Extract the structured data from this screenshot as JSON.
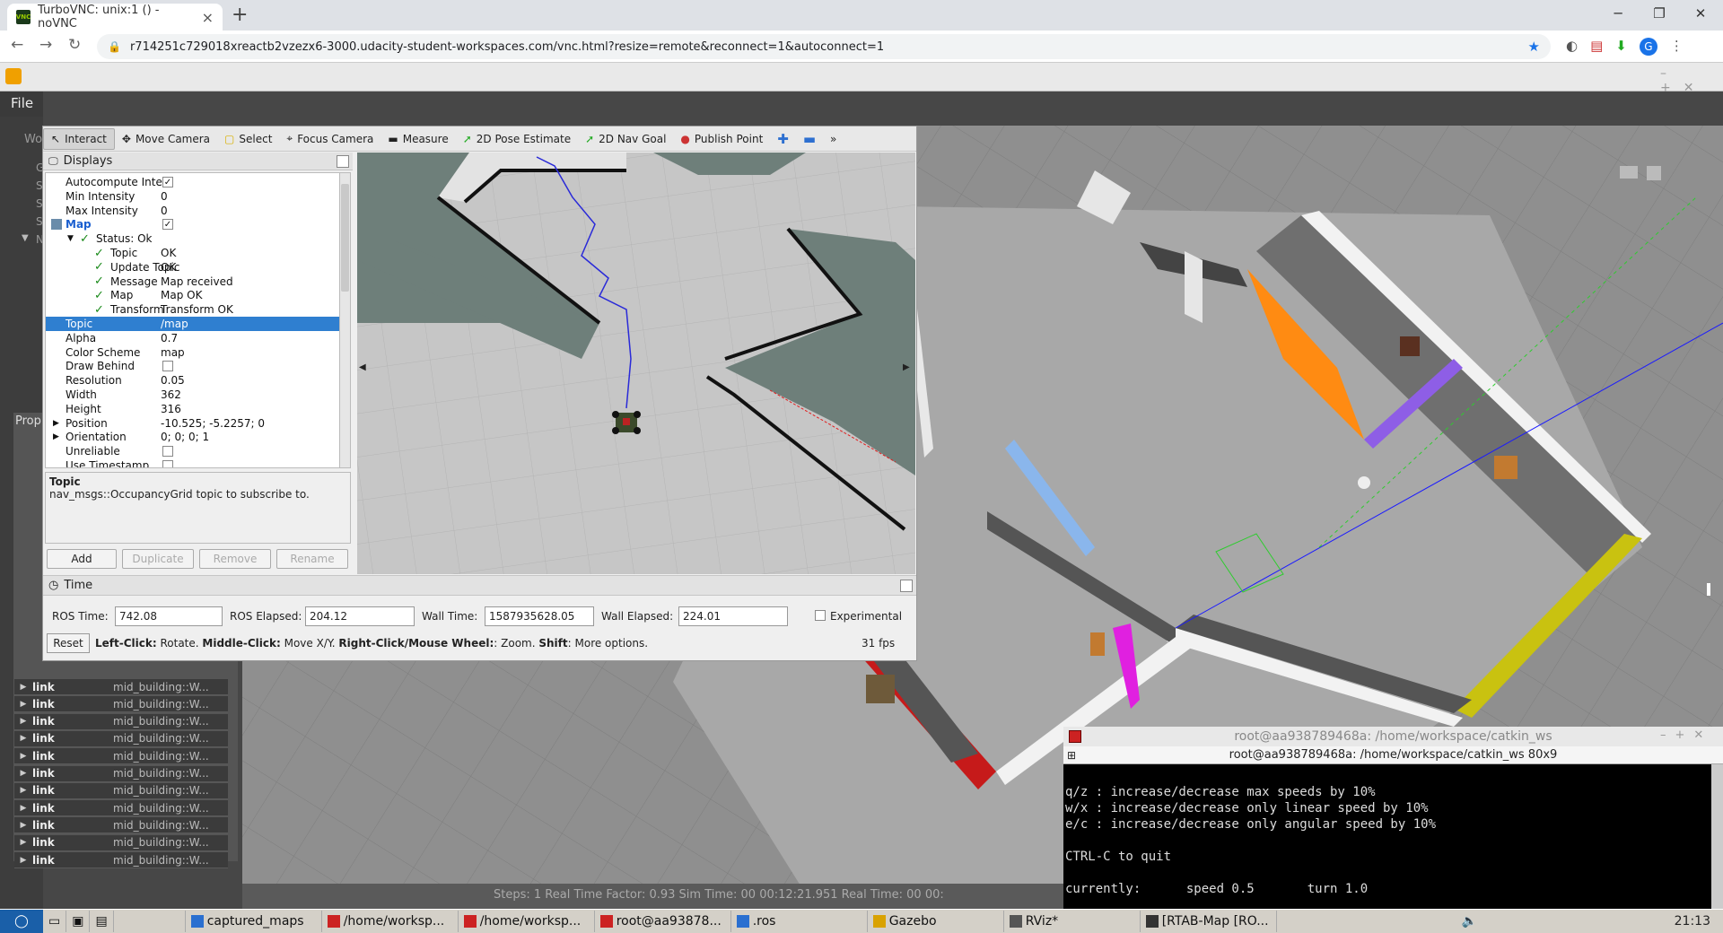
{
  "browser": {
    "tab_title": "TurboVNC: unix:1 () - noVNC",
    "favicon_text": "VNC",
    "url": "r714251c729018xreactb2vzezx6-3000.udacity-student-workspaces.com/vnc.html?resize=remote&reconnect=1&autoconnect=1",
    "profile": "G"
  },
  "gazebo": {
    "menu_file": "File",
    "left_labels": [
      "Wo",
      "G",
      "S",
      "S",
      "S",
      "N"
    ],
    "props_label": "Prop",
    "link_rows": [
      {
        "k": "link",
        "v": "mid_building::W..."
      },
      {
        "k": "link",
        "v": "mid_building::W..."
      },
      {
        "k": "link",
        "v": "mid_building::W..."
      },
      {
        "k": "link",
        "v": "mid_building::W..."
      },
      {
        "k": "link",
        "v": "mid_building::W..."
      },
      {
        "k": "link",
        "v": "mid_building::W..."
      },
      {
        "k": "link",
        "v": "mid_building::W..."
      },
      {
        "k": "link",
        "v": "mid_building::W..."
      },
      {
        "k": "link",
        "v": "mid_building::W..."
      },
      {
        "k": "link",
        "v": "mid_building::W..."
      },
      {
        "k": "link",
        "v": "mid_building::W..."
      }
    ],
    "bottom_bar": "Steps: 1    Real Time Factor: 0.93    Sim Time: 00 00:12:21.951    Real Time: 00 00:"
  },
  "rviz": {
    "tools": [
      "Interact",
      "Move Camera",
      "Select",
      "Focus Camera",
      "Measure",
      "2D Pose Estimate",
      "2D Nav Goal",
      "Publish Point"
    ],
    "displays_title": "Displays",
    "tree": [
      {
        "k": "Autocompute Inte...",
        "v": "",
        "check": "checked",
        "indent": 22
      },
      {
        "k": "Min Intensity",
        "v": "0",
        "indent": 22
      },
      {
        "k": "Max Intensity",
        "v": "0",
        "indent": 22
      },
      {
        "k": "Map",
        "v": "",
        "check": "checked",
        "indent": 22,
        "bold": true
      },
      {
        "k": "Status: Ok",
        "v": "",
        "indent": 40,
        "green": true,
        "expand": true
      },
      {
        "k": "Topic",
        "v": "OK",
        "indent": 56,
        "green": true
      },
      {
        "k": "Update Topic",
        "v": "OK",
        "indent": 56,
        "green": true
      },
      {
        "k": "Message",
        "v": "Map received",
        "indent": 56,
        "green": true
      },
      {
        "k": "Map",
        "v": "Map OK",
        "indent": 56,
        "green": true
      },
      {
        "k": "Transform",
        "v": "Transform OK",
        "indent": 56,
        "green": true
      },
      {
        "k": "Topic",
        "v": "/map",
        "indent": 22,
        "sel": true
      },
      {
        "k": "Alpha",
        "v": "0.7",
        "indent": 22
      },
      {
        "k": "Color Scheme",
        "v": "map",
        "indent": 22
      },
      {
        "k": "Draw Behind",
        "v": "",
        "check": "unchecked",
        "indent": 22
      },
      {
        "k": "Resolution",
        "v": "0.05",
        "indent": 22
      },
      {
        "k": "Width",
        "v": "362",
        "indent": 22
      },
      {
        "k": "Height",
        "v": "316",
        "indent": 22
      },
      {
        "k": "Position",
        "v": "-10.525; -5.2257; 0",
        "indent": 22,
        "expand_right": true
      },
      {
        "k": "Orientation",
        "v": "0; 0; 0; 1",
        "indent": 22,
        "expand_right": true
      },
      {
        "k": "Unreliable",
        "v": "",
        "check": "unchecked",
        "indent": 22
      },
      {
        "k": "Use Timestamp",
        "v": "",
        "check": "unchecked",
        "indent": 22
      }
    ],
    "desc_title": "Topic",
    "desc_text": "nav_msgs::OccupancyGrid topic to subscribe to.",
    "btn_add": "Add",
    "btn_duplicate": "Duplicate",
    "btn_remove": "Remove",
    "btn_rename": "Rename",
    "time_title": "Time",
    "ros_time_label": "ROS Time:",
    "ros_time": "742.08",
    "ros_elapsed_label": "ROS Elapsed:",
    "ros_elapsed": "204.12",
    "wall_time_label": "Wall Time:",
    "wall_time": "1587935628.05",
    "wall_elapsed_label": "Wall Elapsed:",
    "wall_elapsed": "224.01",
    "experimental": "Experimental",
    "reset": "Reset",
    "hint_b1": "Left-Click:",
    "hint_t1": " Rotate. ",
    "hint_b2": "Middle-Click:",
    "hint_t2": " Move X/Y. ",
    "hint_b3": "Right-Click/Mouse Wheel:",
    "hint_t3": ": Zoom. ",
    "hint_b4": "Shift",
    "hint_t4": ": More options.",
    "fps": "31 fps"
  },
  "terminal": {
    "title": "root@aa938789468a: /home/workspace/catkin_ws",
    "subtitle": "root@aa938789468a: /home/workspace/catkin_ws 80x9",
    "body": "q/z : increase/decrease max speeds by 10%\nw/x : increase/decrease only linear speed by 10%\ne/c : increase/decrease only angular speed by 10%\n\nCTRL-C to quit\n\ncurrently:      speed 0.5       turn 1.0"
  },
  "taskbar": {
    "items": [
      "captured_maps",
      "/home/worksp...",
      "/home/worksp...",
      "root@aa93878...",
      ".ros",
      "Gazebo",
      "RViz*",
      "[RTAB-Map [RO..."
    ],
    "clock": "21:13"
  }
}
